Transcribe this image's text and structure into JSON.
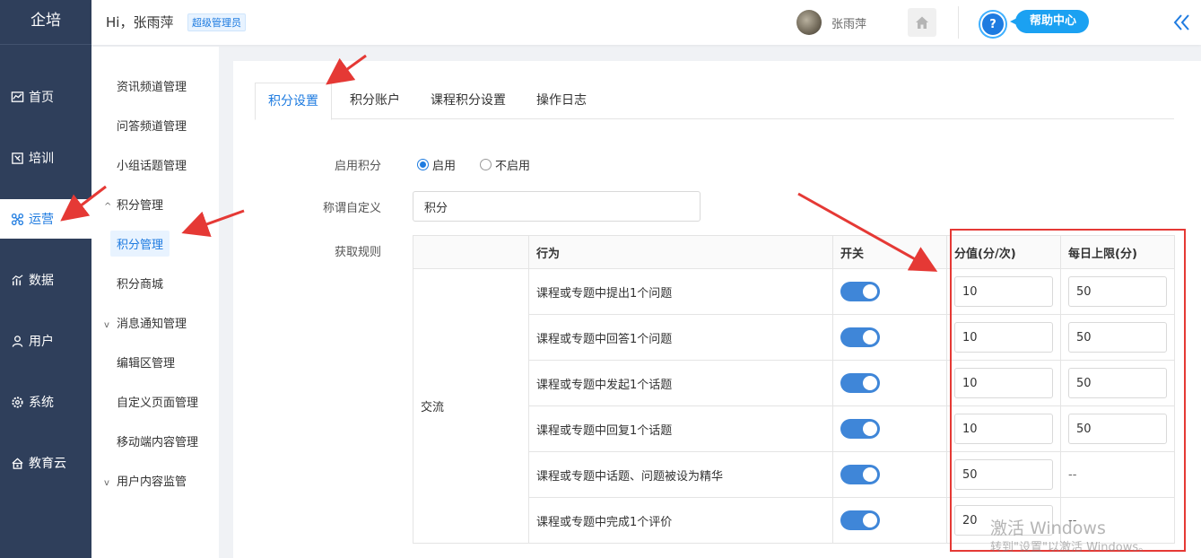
{
  "app": {
    "logo": "企培"
  },
  "header": {
    "greeting": "Hi，张雨萍",
    "role_badge": "超级管理员",
    "username": "张雨萍",
    "help_label": "帮助中心",
    "help_icon": "?",
    "collapse_icon": "double-chevron-left-icon"
  },
  "nav": [
    {
      "label": "首页",
      "icon": "chart-icon"
    },
    {
      "label": "培训",
      "icon": "book-icon"
    },
    {
      "label": "运营",
      "icon": "cluster-icon",
      "active": true
    },
    {
      "label": "数据",
      "icon": "bar-chart-icon"
    },
    {
      "label": "用户",
      "icon": "user-icon"
    },
    {
      "label": "系统",
      "icon": "gear-icon"
    },
    {
      "label": "教育云",
      "icon": "cloud-home-icon"
    }
  ],
  "subnav": {
    "items": [
      "资讯频道管理",
      "问答频道管理",
      "小组话题管理",
      "积分管理",
      "积分管理",
      "积分商城",
      "消息通知管理",
      "编辑区管理",
      "自定义页面管理",
      "移动端内容管理",
      "用户内容监管"
    ],
    "expanded_caret": "^",
    "collapsed_caret": "v"
  },
  "tabs": [
    "积分设置",
    "积分账户",
    "课程积分设置",
    "操作日志"
  ],
  "form": {
    "enable_label": "启用积分",
    "radio_on": "启用",
    "radio_off": "不启用",
    "alias_label": "称谓自定义",
    "alias_value": "积分",
    "rules_label": "获取规则"
  },
  "table": {
    "headers": [
      "",
      "行为",
      "开关",
      "分值(分/次)",
      "每日上限(分)"
    ],
    "category": "交流",
    "rows": [
      {
        "action": "课程或专题中提出1个问题",
        "score": "10",
        "limit": "50"
      },
      {
        "action": "课程或专题中回答1个问题",
        "score": "10",
        "limit": "50"
      },
      {
        "action": "课程或专题中发起1个话题",
        "score": "10",
        "limit": "50"
      },
      {
        "action": "课程或专题中回复1个话题",
        "score": "10",
        "limit": "50"
      },
      {
        "action": "课程或专题中话题、问题被设为精华",
        "score": "50",
        "limit": "--"
      },
      {
        "action": "课程或专题中完成1个评价",
        "score": "20",
        "limit": "--"
      }
    ]
  },
  "watermark": {
    "line1": "激活 Windows",
    "line2": "转到\"设置\"以激活 Windows。"
  },
  "colors": {
    "nav_bg": "#2f3f5b",
    "accent": "#1e7be0",
    "annotation": "#e53935"
  }
}
